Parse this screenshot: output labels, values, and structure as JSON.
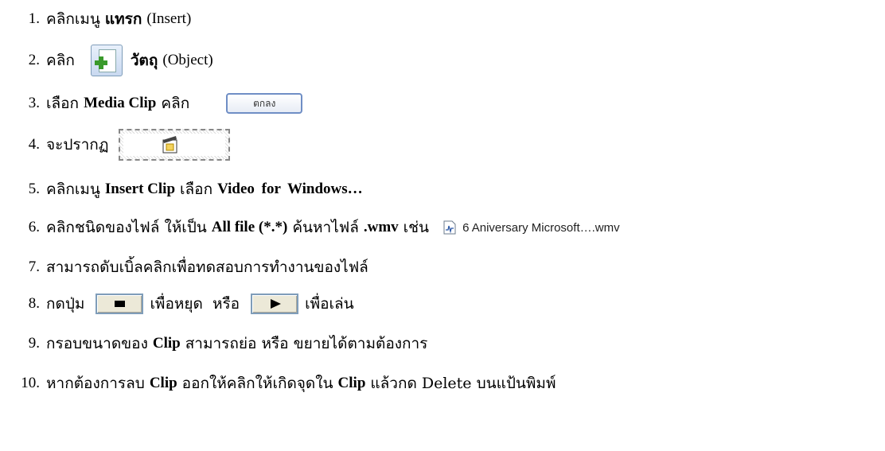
{
  "steps": [
    {
      "num": "1.",
      "a": "คลิกเมนู",
      "b": "แทรก",
      "c": "(Insert)"
    },
    {
      "num": "2.",
      "a": "คลิก",
      "b": "วัตถุ",
      "c": "(Object)"
    },
    {
      "num": "3.",
      "a": "เลือก",
      "b": "Media Clip",
      "c": "คลิก",
      "button": "ตกลง"
    },
    {
      "num": "4.",
      "a": "จะปรากฏ"
    },
    {
      "num": "5.",
      "a": "คลิกเมนู",
      "b": "Insert Clip",
      "c": "เลือก",
      "d": "Video for Windows…"
    },
    {
      "num": "6.",
      "a": "คลิกชนิดของไฟล์ ให้เป็น",
      "b": "All file (*.*)",
      "c": "ค้นหาไฟล์",
      "d": ".wmv",
      "e": "เช่น",
      "file": "6 Aniversary Microsoft….wmv"
    },
    {
      "num": "7.",
      "a": "สามารถดับเบิ้ลคลิกเพื่อทดสอบการทำงานของไฟล์"
    },
    {
      "num": "8.",
      "a": "กดปุ่ม",
      "b": "เพื่อหยุด  หรือ",
      "c": "เพื่อเล่น"
    },
    {
      "num": "9.",
      "a": "กรอบขนาดของ",
      "b": "Clip",
      "c": "สามารถย่อ หรือ ขยายได้ตามต้องการ"
    },
    {
      "num": "10.",
      "a": "หากต้องการลบ",
      "b": "Clip",
      "c": "ออกให้คลิกให้เกิดจุดใน",
      "d": "Clip",
      "e": "แล้วกด Delete บนแป้นพิมพ์"
    }
  ]
}
